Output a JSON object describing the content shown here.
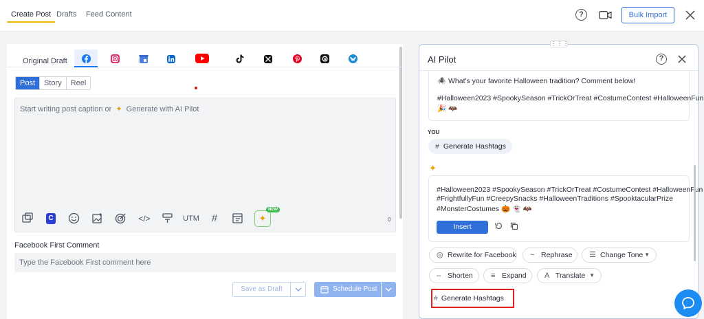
{
  "topbar": {
    "tabs": [
      {
        "label": "Create Post",
        "active": true
      },
      {
        "label": "Drafts",
        "active": false
      },
      {
        "label": "Feed Content",
        "active": false
      }
    ],
    "help_label": "?",
    "bulk_import_label": "Bulk Import"
  },
  "composer": {
    "original_draft_label": "Original Draft",
    "channels": [
      "facebook-icon",
      "instagram-icon",
      "google-business-icon",
      "linkedin-icon",
      "youtube-icon",
      "tiktok-icon",
      "x-icon",
      "pinterest-icon",
      "threads-icon",
      "bluesky-icon"
    ],
    "active_channel": "facebook-icon",
    "post_types": [
      {
        "label": "Post",
        "active": true
      },
      {
        "label": "Story",
        "active": false
      },
      {
        "label": "Reel",
        "active": false
      }
    ],
    "editor_placeholder": "Start writing post caption or",
    "editor_ai_link": "Generate with AI Pilot",
    "toolbar": {
      "utm_label": "UTM",
      "hash_label": "#",
      "new_badge": "NEW",
      "char_count": "0"
    },
    "first_comment_label": "Facebook First Comment",
    "first_comment_placeholder": "Type the Facebook First comment here",
    "save_draft_label": "Save as Draft",
    "schedule_label": "Schedule Post"
  },
  "ai_pilot": {
    "title": "AI Pilot",
    "help_label": "?",
    "drag_handle": "⋮⋮⋮",
    "previous_message": {
      "line1": "🕷️ What's your favorite Halloween tradition? Comment below!",
      "line2": "#Halloween2023 #SpookySeason #TrickOrTreat #CostumeContest #HalloweenFun",
      "line3": "🎉 🦇"
    },
    "you_label": "YOU",
    "user_prompt": "Generate Hashtags",
    "response": {
      "line1": "#Halloween2023 #SpookySeason #TrickOrTreat #CostumeContest #HalloweenFun",
      "line2": "#FrightfullyFun #CreepySnacks #HalloweenTraditions #SpooktacularPrize",
      "line3": "#MonsterCostumes 🎃 👻 🦇"
    },
    "insert_label": "Insert",
    "actions": {
      "rewrite": "Rewrite for Facebook",
      "rephrase": "Rephrase",
      "change_tone": "Change Tone",
      "shorten": "Shorten",
      "expand": "Expand",
      "translate": "Translate",
      "generate_hashtags": "Generate Hashtags"
    }
  }
}
